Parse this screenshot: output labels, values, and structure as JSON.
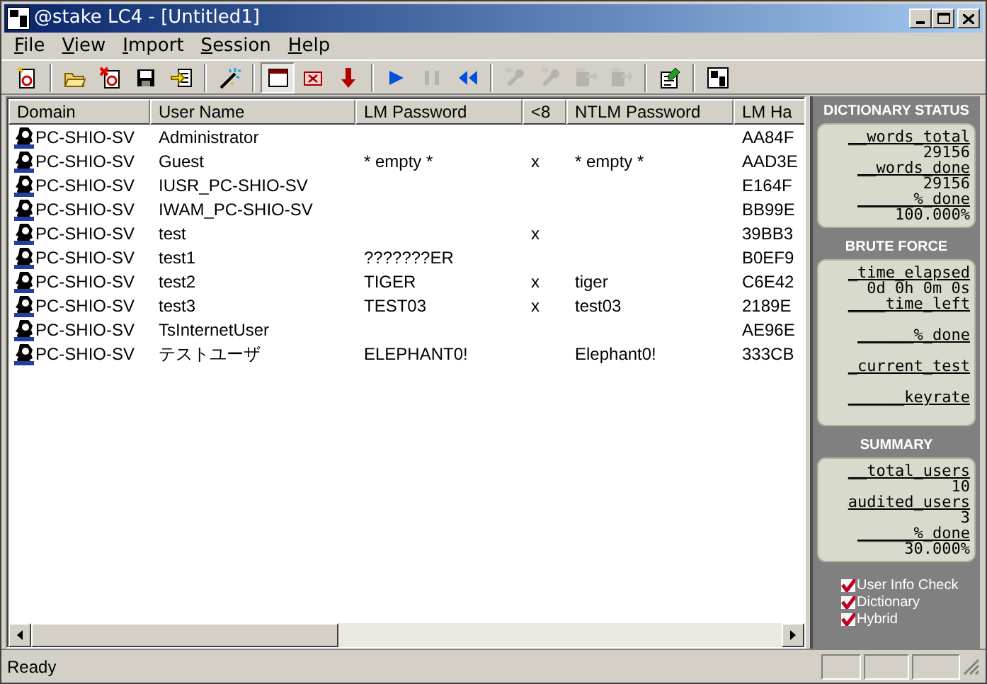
{
  "window": {
    "title": "@stake LC4 - [Untitled1]"
  },
  "menu": [
    "File",
    "View",
    "Import",
    "Session",
    "Help"
  ],
  "toolbar": [
    {
      "kind": "new",
      "disabled": false,
      "pressed": false
    },
    {
      "kind": "sep"
    },
    {
      "kind": "open",
      "disabled": false,
      "pressed": false
    },
    {
      "kind": "remove",
      "disabled": false,
      "pressed": false
    },
    {
      "kind": "save",
      "disabled": false,
      "pressed": false
    },
    {
      "kind": "import",
      "disabled": false,
      "pressed": false
    },
    {
      "kind": "sep"
    },
    {
      "kind": "wand",
      "disabled": false,
      "pressed": false
    },
    {
      "kind": "sep"
    },
    {
      "kind": "window",
      "disabled": false,
      "pressed": true
    },
    {
      "kind": "stop",
      "disabled": false,
      "pressed": false
    },
    {
      "kind": "down",
      "disabled": false,
      "pressed": false
    },
    {
      "kind": "sep"
    },
    {
      "kind": "play",
      "disabled": false,
      "pressed": false
    },
    {
      "kind": "pause",
      "disabled": true,
      "pressed": false
    },
    {
      "kind": "rewind",
      "disabled": false,
      "pressed": false
    },
    {
      "kind": "sep"
    },
    {
      "kind": "key",
      "disabled": true,
      "pressed": false
    },
    {
      "kind": "key",
      "disabled": true,
      "pressed": false
    },
    {
      "kind": "export",
      "disabled": true,
      "pressed": false
    },
    {
      "kind": "export",
      "disabled": true,
      "pressed": false
    },
    {
      "kind": "sep"
    },
    {
      "kind": "props",
      "disabled": false,
      "pressed": false
    },
    {
      "kind": "sep"
    },
    {
      "kind": "logo",
      "disabled": false,
      "pressed": false
    }
  ],
  "table": {
    "columns": [
      "Domain",
      "User Name",
      "LM Password",
      "<8",
      "NTLM Password",
      "LM Ha"
    ],
    "rows": [
      [
        "PC-SHIO-SV",
        "Administrator",
        "",
        "",
        "",
        "AA84F"
      ],
      [
        "PC-SHIO-SV",
        "Guest",
        "* empty *",
        "x",
        "* empty *",
        "AAD3E"
      ],
      [
        "PC-SHIO-SV",
        "IUSR_PC-SHIO-SV",
        "",
        "",
        "",
        "E164F"
      ],
      [
        "PC-SHIO-SV",
        "IWAM_PC-SHIO-SV",
        "",
        "",
        "",
        "BB99E"
      ],
      [
        "PC-SHIO-SV",
        "test",
        "",
        "x",
        "",
        "39BB3"
      ],
      [
        "PC-SHIO-SV",
        "test1",
        "???????ER",
        "",
        "",
        "B0EF9"
      ],
      [
        "PC-SHIO-SV",
        "test2",
        "TIGER",
        "x",
        "tiger",
        "C6E42"
      ],
      [
        "PC-SHIO-SV",
        "test3",
        "TEST03",
        "x",
        "test03",
        "2189E"
      ],
      [
        "PC-SHIO-SV",
        "TsInternetUser",
        "",
        "",
        "",
        "AE96E"
      ],
      [
        "PC-SHIO-SV",
        "テストユーザ",
        "ELEPHANT0!",
        "",
        "Elephant0!",
        "333CB"
      ]
    ]
  },
  "panel": [
    {
      "heading": "DICTIONARY STATUS",
      "fields": [
        {
          "label": "__words_total",
          "value": "29156"
        },
        {
          "label": "__words_done",
          "value": "29156"
        },
        {
          "label": "______%_done",
          "value": "100.000%"
        }
      ]
    },
    {
      "heading": "BRUTE FORCE",
      "fields": [
        {
          "label": "_time_elapsed",
          "value": "0d 0h 0m 0s"
        },
        {
          "label": "____time_left"
        },
        {
          "label": "______%_done"
        },
        {
          "label": "_current_test"
        },
        {
          "label": "______keyrate"
        }
      ]
    },
    {
      "heading": "SUMMARY",
      "fields": [
        {
          "label": "__total_users",
          "value": "10"
        },
        {
          "label": "audited_users",
          "value": "3"
        },
        {
          "label": "______%_done",
          "value": "30.000%"
        }
      ]
    }
  ],
  "options": [
    {
      "label": "User Info Check",
      "checked": true
    },
    {
      "label": "Dictionary",
      "checked": true
    },
    {
      "label": "Hybrid",
      "checked": true
    }
  ],
  "status_bar": {
    "text": "Ready"
  }
}
